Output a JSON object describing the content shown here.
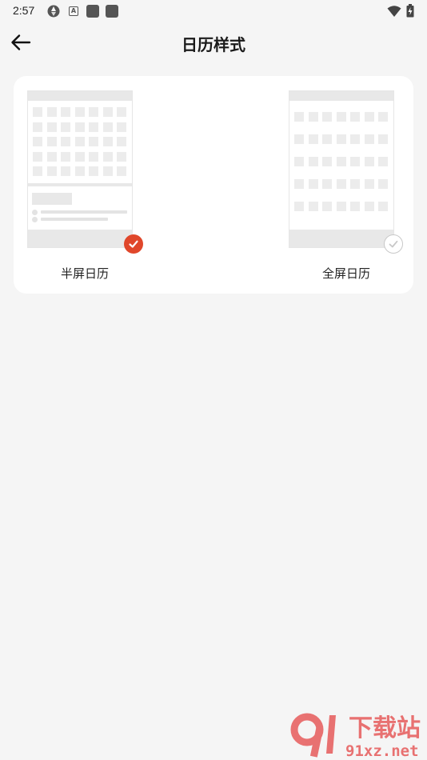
{
  "status_bar": {
    "time": "2:57",
    "icons": [
      "aperture-icon",
      "a-badge-icon",
      "app-square-icon",
      "app-square-icon",
      "wifi-icon",
      "battery-icon"
    ]
  },
  "header": {
    "back_icon": "arrow-left-icon",
    "title": "日历样式"
  },
  "options": [
    {
      "label": "半屏日历",
      "selected": true
    },
    {
      "label": "全屏日历",
      "selected": false
    }
  ],
  "colors": {
    "accent": "#e0472b",
    "background": "#f5f5f5",
    "card": "#ffffff",
    "placeholder": "#e8e8e8"
  },
  "watermark": {
    "brand_cn": "下载站",
    "domain": "91xz.net"
  }
}
